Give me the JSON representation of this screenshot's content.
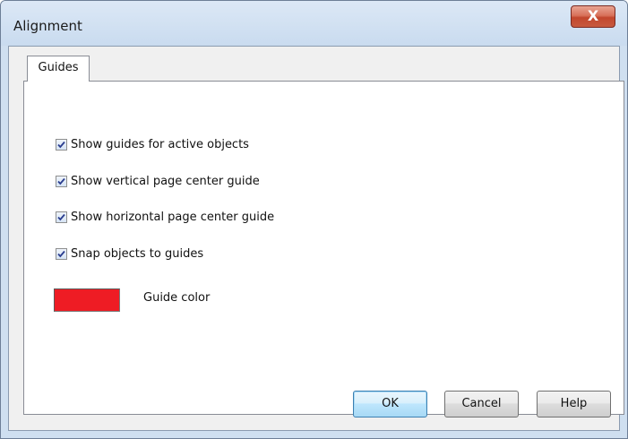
{
  "window": {
    "title": "Alignment",
    "close_symbol": "X",
    "close_icon": "close-icon"
  },
  "tabs": [
    {
      "label": "Guides",
      "active": true
    }
  ],
  "options": [
    {
      "label": "Show guides for active objects",
      "checked": true
    },
    {
      "label": "Show vertical page center guide",
      "checked": true
    },
    {
      "label": "Show horizontal page center guide",
      "checked": true
    },
    {
      "label": "Snap objects to guides",
      "checked": true
    }
  ],
  "guide_color": {
    "label": "Guide color",
    "value": "#ee1c24"
  },
  "buttons": {
    "ok": "OK",
    "cancel": "Cancel",
    "help": "Help"
  }
}
